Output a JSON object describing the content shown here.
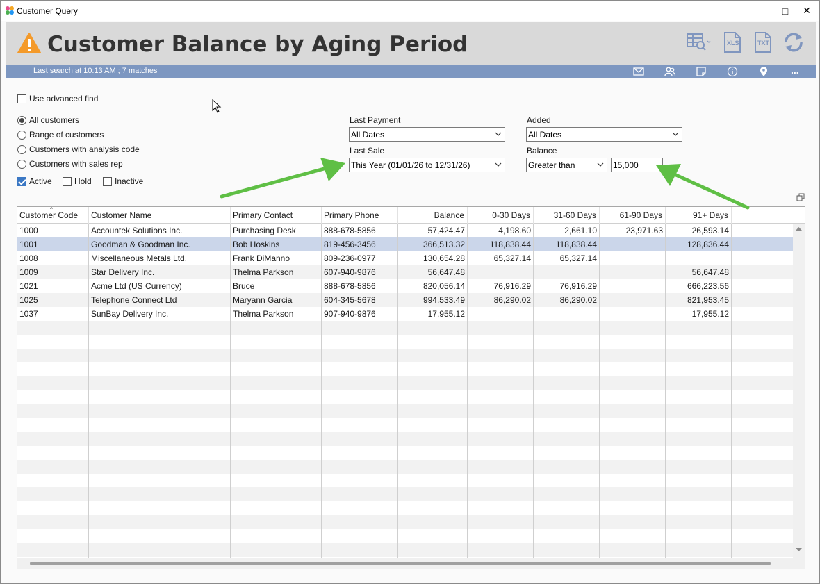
{
  "window": {
    "title": "Customer Query",
    "maximize_glyph": "□",
    "close_glyph": "✕"
  },
  "header": {
    "title": "Customer Balance by Aging Period",
    "status": "Last search at 10:13 AM ; 7 matches",
    "xls_label": "XLS",
    "txt_label": "TXT",
    "more_label": "...",
    "accent_color": "#7d97c1"
  },
  "filters": {
    "advanced_find": "Use advanced find",
    "radios": [
      "All customers",
      "Range of customers",
      "Customers with analysis code",
      "Customers with sales rep"
    ],
    "status_checks": [
      "Active",
      "Hold",
      "Inactive"
    ],
    "last_payment": {
      "label": "Last Payment",
      "value": "All Dates"
    },
    "added": {
      "label": "Added",
      "value": "All Dates"
    },
    "last_sale": {
      "label": "Last Sale",
      "value": "This Year (01/01/26 to 12/31/26)"
    },
    "balance": {
      "label": "Balance",
      "operator": "Greater than",
      "value": "15,000"
    }
  },
  "table": {
    "columns": [
      "Customer Code",
      "Customer Name",
      "Primary Contact",
      "Primary Phone",
      "Balance",
      "0-30 Days",
      "31-60 Days",
      "61-90 Days",
      "91+ Days"
    ],
    "rows": [
      [
        "1000",
        "Accountek Solutions Inc.",
        "Purchasing Desk",
        "888-678-5856",
        "57,424.47",
        "4,198.60",
        "2,661.10",
        "23,971.63",
        "26,593.14"
      ],
      [
        "1001",
        "Goodman & Goodman Inc.",
        "Bob Hoskins",
        "819-456-3456",
        "366,513.32",
        "118,838.44",
        "118,838.44",
        "",
        "128,836.44"
      ],
      [
        "1008",
        "Miscellaneous Metals Ltd.",
        "Frank DiManno",
        "809-236-0977",
        "130,654.28",
        "65,327.14",
        "65,327.14",
        "",
        ""
      ],
      [
        "1009",
        "Star Delivery Inc.",
        "Thelma Parkson",
        "607-940-9876",
        "56,647.48",
        "",
        "",
        "",
        "56,647.48"
      ],
      [
        "1021",
        "Acme Ltd (US Currency)",
        "Bruce",
        "888-678-5856",
        "820,056.14",
        "76,916.29",
        "76,916.29",
        "",
        "666,223.56"
      ],
      [
        "1025",
        "Telephone Connect Ltd",
        "Maryann Garcia",
        "604-345-5678",
        "994,533.49",
        "86,290.02",
        "86,290.02",
        "",
        "821,953.45"
      ],
      [
        "1037",
        "SunBay Delivery Inc.",
        "Thelma Parkson",
        "907-940-9876",
        "17,955.12",
        "",
        "",
        "",
        "17,955.12"
      ]
    ],
    "selected_row": 1
  }
}
